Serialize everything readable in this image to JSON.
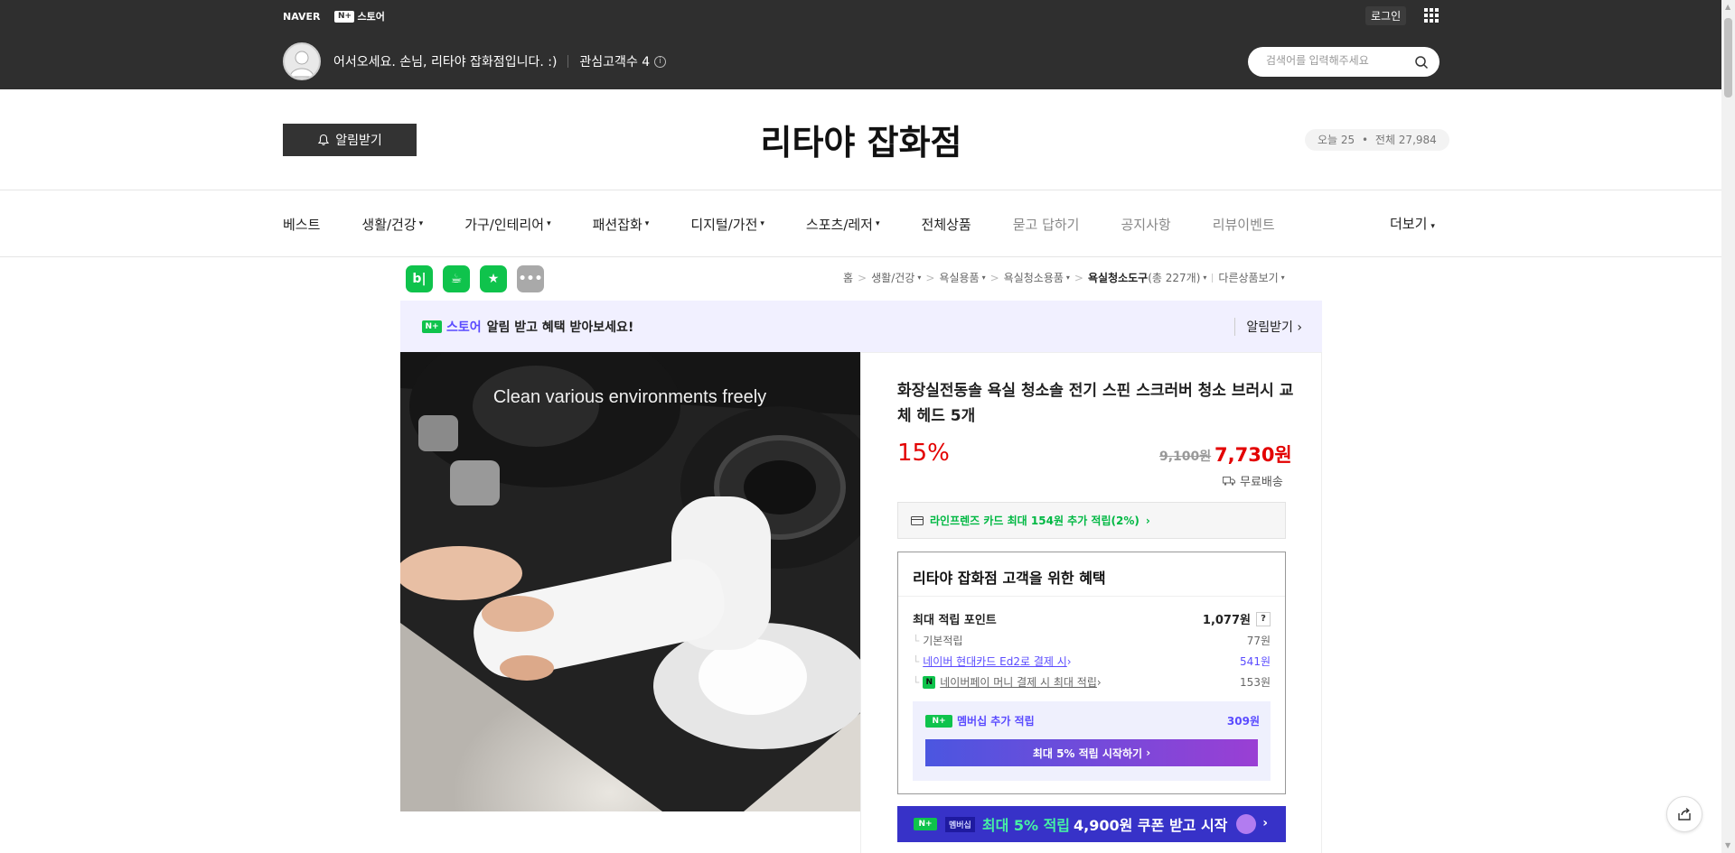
{
  "topbar": {
    "naver_logo": "NAVER",
    "nplus_box": "N+",
    "store_word": "스토어",
    "login_label": "로그인",
    "apps_icon": "grid-icon",
    "welcome_text": "어서오세요. 손님, 리타야 잡화점입니다. :)",
    "followers_text": "관심고객수 4",
    "search_placeholder": "검색어를 입력해주세요"
  },
  "header": {
    "alarm_label": "알림받기",
    "store_title": "리타야 잡화점",
    "visits_today": "오늘 25",
    "visits_total": "전체 27,984"
  },
  "nav": {
    "items": [
      {
        "label": "베스트"
      },
      {
        "label": "생활/건강"
      },
      {
        "label": "가구/인테리어"
      },
      {
        "label": "패션잡화"
      },
      {
        "label": "디지털/가전"
      },
      {
        "label": "스포츠/레저"
      },
      {
        "label": "전체상품"
      },
      {
        "label": "묻고 답하기"
      },
      {
        "label": "공지사항"
      },
      {
        "label": "리뷰이벤트"
      }
    ],
    "more_label": "더보기"
  },
  "share_icons": [
    "blog-icon",
    "talk-icon",
    "bookmark-icon",
    "more-icon"
  ],
  "breadcrumb": {
    "items": [
      "홈",
      "생활/건강",
      "욕실용품",
      "욕실청소용품"
    ],
    "current": "욕실청소도구",
    "count": "(총 227개)",
    "other": "다른상품보기"
  },
  "promo": {
    "nplus": "N+",
    "store_word": "스토어",
    "text": "알림 받고 혜택 받아보세요!",
    "notify_label": "알림받기"
  },
  "product": {
    "image_caption": "Clean various environments freely",
    "title": "화장실전동솔 욕실 청소솔 전기 스핀 스크러버 청소 브러시  교체 헤드 5개",
    "discount": "15%",
    "original_price": "9,100원",
    "sale_price": "7,730원",
    "shipping": "무료배송",
    "card_promo": "라인프렌즈 카드 최대 154원 추가 적립(2%)"
  },
  "benefit": {
    "header": "리타야 잡화점 고객을 위한 혜택",
    "max_points_label": "최대 적립 포인트",
    "max_points_value": "1,077원",
    "qmark": "?",
    "rows": [
      {
        "label": "기본적립",
        "value": "77원"
      },
      {
        "label": "네이버 현대카드 Ed2로 결제 시",
        "value": "541원"
      },
      {
        "label": "네이버페이 머니 결제 시 최대 적립",
        "value": "153원"
      }
    ],
    "npay_badge": "N",
    "membership_badge": "N+",
    "membership_label": "멤버십 추가 적립",
    "membership_value": "309원",
    "membership_button": "최대 5% 적립 시작하기"
  },
  "coupon": {
    "badge": "N+",
    "tag": "멤버십",
    "highlight": "최대 5% 적립",
    "text": "4,900원 쿠폰 받고 시작"
  },
  "colors": {
    "topbar_bg": "#2f2f2f",
    "sale_red": "#e30000",
    "naver_green": "#0fc34c",
    "accent_purple": "#5a4bff",
    "coupon_bg": "#3732c8"
  }
}
